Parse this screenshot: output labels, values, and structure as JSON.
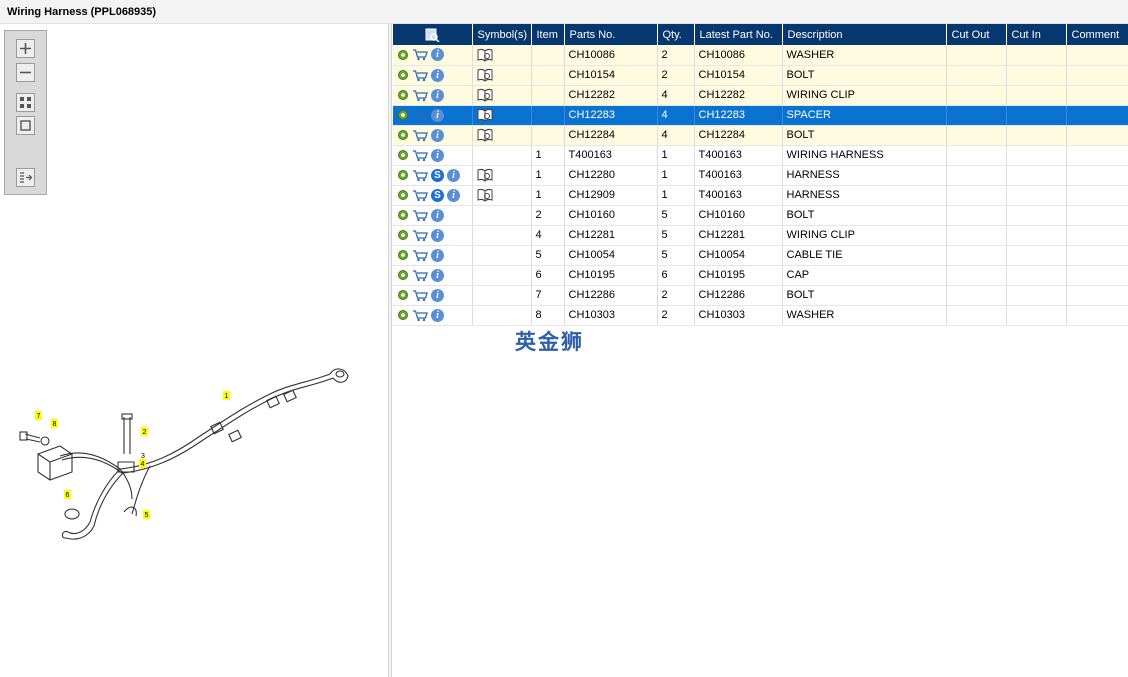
{
  "window": {
    "title": "Wiring Harness (PPL068935)"
  },
  "toolbar": {
    "buttons": [
      {
        "name": "zoom-in-button",
        "icon": "plus-icon"
      },
      {
        "name": "zoom-out-button",
        "icon": "minus-icon"
      },
      {
        "name": "fit-all-button",
        "icon": "grid-icon"
      },
      {
        "name": "actual-size-button",
        "icon": "square-icon"
      },
      {
        "name": "export-button",
        "icon": "list-arrow-icon"
      }
    ]
  },
  "grid": {
    "columns": [
      "",
      "Symbol(s)",
      "Item",
      "Parts No.",
      "Qty.",
      "Latest Part No.",
      "Description",
      "Cut Out",
      "Cut In",
      "Comment"
    ],
    "rows": [
      {
        "s": false,
        "book": true,
        "item": "",
        "part": "CH10086",
        "qty": "2",
        "latest": "CH10086",
        "desc": "WASHER",
        "style": "hl"
      },
      {
        "s": false,
        "book": true,
        "item": "",
        "part": "CH10154",
        "qty": "2",
        "latest": "CH10154",
        "desc": "BOLT",
        "style": "hl"
      },
      {
        "s": false,
        "book": true,
        "item": "",
        "part": "CH12282",
        "qty": "4",
        "latest": "CH12282",
        "desc": "WIRING CLIP",
        "style": "hl"
      },
      {
        "s": false,
        "book": true,
        "item": "",
        "part": "CH12283",
        "qty": "4",
        "latest": "CH12283",
        "desc": "SPACER",
        "style": "sel"
      },
      {
        "s": false,
        "book": true,
        "item": "",
        "part": "CH12284",
        "qty": "4",
        "latest": "CH12284",
        "desc": "BOLT",
        "style": "hl"
      },
      {
        "s": false,
        "book": false,
        "item": "1",
        "part": "T400163",
        "qty": "1",
        "latest": "T400163",
        "desc": "WIRING HARNESS",
        "style": ""
      },
      {
        "s": true,
        "book": true,
        "item": "1",
        "part": "CH12280",
        "qty": "1",
        "latest": "T400163",
        "desc": "HARNESS",
        "style": ""
      },
      {
        "s": true,
        "book": true,
        "item": "1",
        "part": "CH12909",
        "qty": "1",
        "latest": "T400163",
        "desc": "HARNESS",
        "style": ""
      },
      {
        "s": false,
        "book": false,
        "item": "2",
        "part": "CH10160",
        "qty": "5",
        "latest": "CH10160",
        "desc": "BOLT",
        "style": ""
      },
      {
        "s": false,
        "book": false,
        "item": "4",
        "part": "CH12281",
        "qty": "5",
        "latest": "CH12281",
        "desc": "WIRING CLIP",
        "style": ""
      },
      {
        "s": false,
        "book": false,
        "item": "5",
        "part": "CH10054",
        "qty": "5",
        "latest": "CH10054",
        "desc": "CABLE TIE",
        "style": ""
      },
      {
        "s": false,
        "book": false,
        "item": "6",
        "part": "CH10195",
        "qty": "6",
        "latest": "CH10195",
        "desc": "CAP",
        "style": ""
      },
      {
        "s": false,
        "book": false,
        "item": "7",
        "part": "CH12286",
        "qty": "2",
        "latest": "CH12286",
        "desc": "BOLT",
        "style": ""
      },
      {
        "s": false,
        "book": false,
        "item": "8",
        "part": "CH10303",
        "qty": "2",
        "latest": "CH10303",
        "desc": "WASHER",
        "style": ""
      }
    ],
    "s_label": "S",
    "info_label": "i"
  },
  "drawing": {
    "callouts": [
      "1",
      "2",
      "3",
      "4",
      "5",
      "6",
      "7",
      "8"
    ]
  },
  "watermark": "英金狮",
  "colors": {
    "header": "#07376f",
    "highlight": "#fefbe0",
    "selected": "#0a72d1",
    "callout": "#ffff00"
  }
}
